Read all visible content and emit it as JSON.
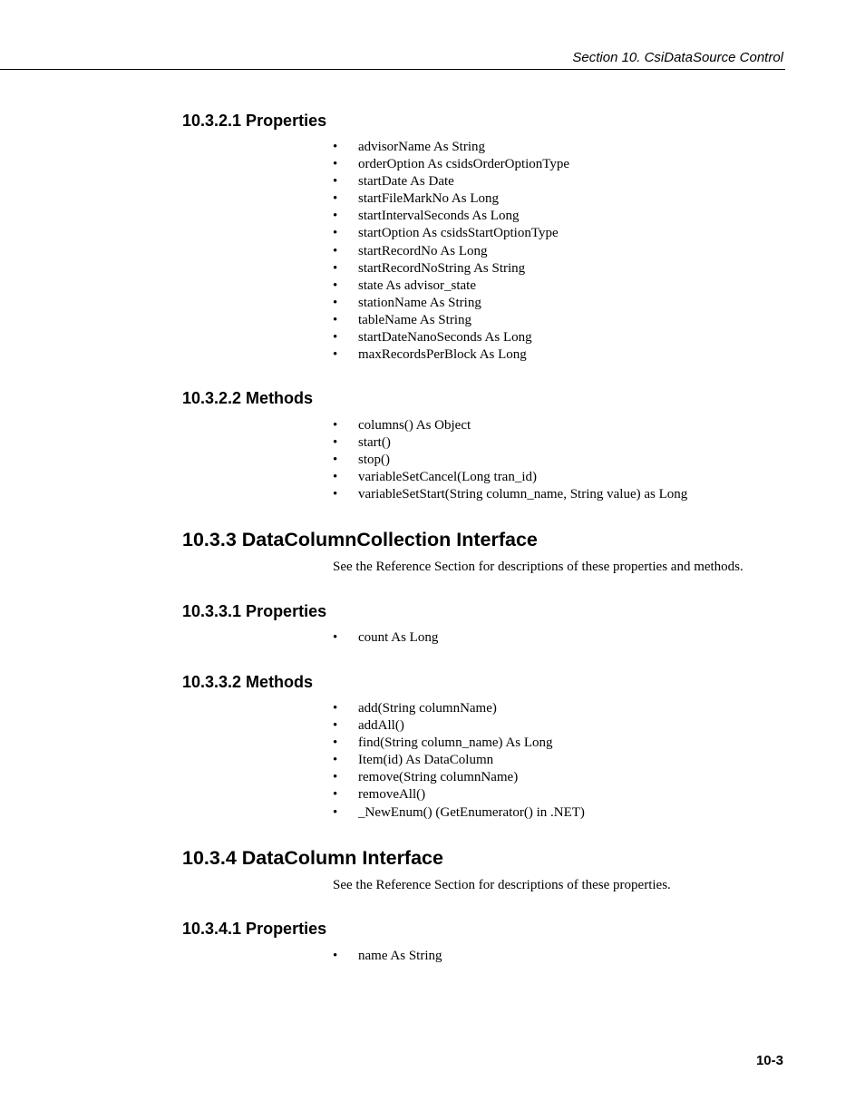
{
  "header": {
    "title": "Section 10.  CsiDataSource Control"
  },
  "sections": {
    "s10321": {
      "heading": "10.3.2.1  Properties",
      "items": [
        "advisorName As String",
        "orderOption As csidsOrderOptionType",
        "startDate As Date",
        "startFileMarkNo As Long",
        "startIntervalSeconds As Long",
        "startOption As csidsStartOptionType",
        "startRecordNo As Long",
        "startRecordNoString As String",
        "state As advisor_state",
        "stationName As String",
        "tableName As String",
        "startDateNanoSeconds As Long",
        "maxRecordsPerBlock As Long"
      ]
    },
    "s10322": {
      "heading": "10.3.2.2  Methods",
      "items": [
        "columns() As Object",
        "start()",
        "stop()",
        "variableSetCancel(Long tran_id)",
        "variableSetStart(String column_name, String value) as Long"
      ]
    },
    "s1033": {
      "heading": "10.3.3  DataColumnCollection Interface",
      "text": "See the Reference Section for descriptions of these properties and methods."
    },
    "s10331": {
      "heading": "10.3.3.1  Properties",
      "items": [
        "count As Long"
      ]
    },
    "s10332": {
      "heading": "10.3.3.2  Methods",
      "items": [
        "add(String columnName)",
        "addAll()",
        "find(String column_name) As Long",
        "Item(id) As DataColumn",
        "remove(String columnName)",
        "removeAll()",
        "_NewEnum() (GetEnumerator() in .NET)"
      ]
    },
    "s1034": {
      "heading": "10.3.4  DataColumn Interface",
      "text": "See the Reference Section for descriptions of these properties."
    },
    "s10341": {
      "heading": "10.3.4.1  Properties",
      "items": [
        "name As String"
      ]
    }
  },
  "bullet_glyph": "•",
  "footer": {
    "page_number": "10-3"
  }
}
